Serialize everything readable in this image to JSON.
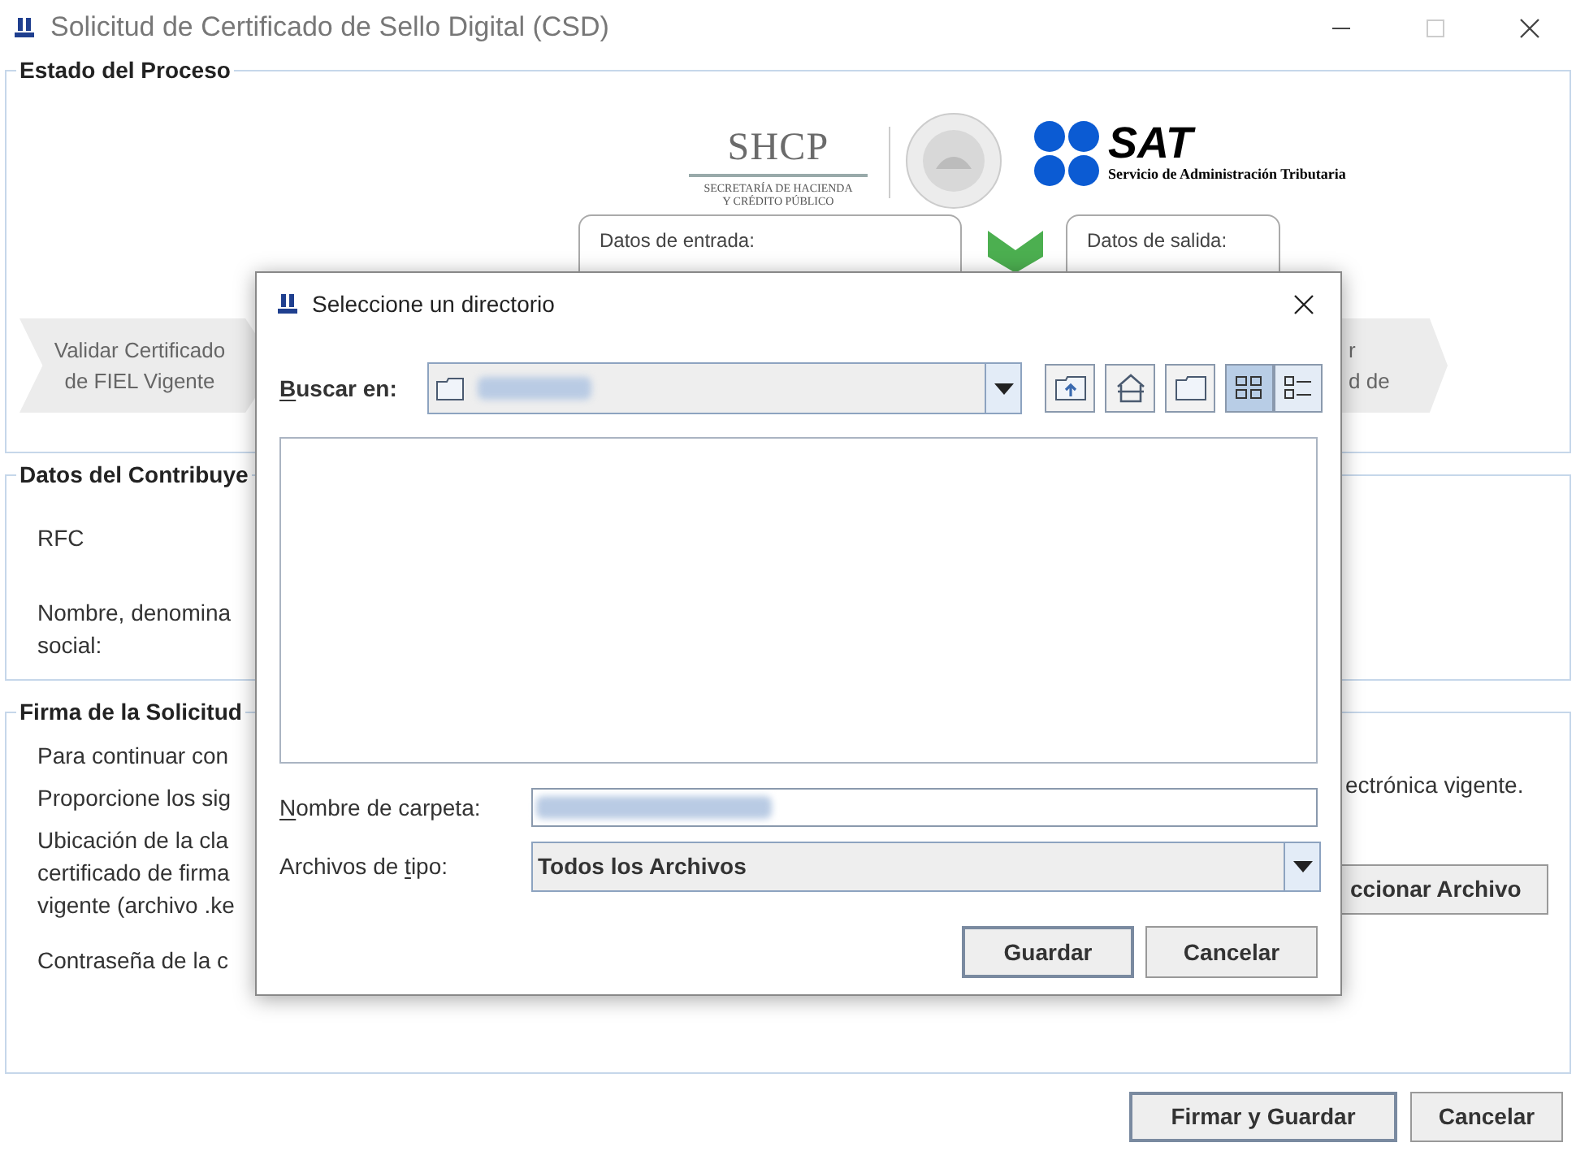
{
  "window": {
    "title": "Solicitud de Certificado de Sello Digital (CSD)"
  },
  "estado": {
    "title": "Estado del Proceso",
    "shcp": {
      "name": "SHCP",
      "lines": [
        "SECRETARÍA DE HACIENDA",
        "Y CRÉDITO PÚBLICO"
      ]
    },
    "sat": {
      "name": "SAT",
      "subtitle": "Servicio de Administración Tributaria"
    },
    "input_box": {
      "title": "Datos de entrada:"
    },
    "output_box": {
      "title": "Datos de salida:"
    },
    "steps": [
      {
        "lines": [
          "Validar Certificado",
          "de FIEL Vigente"
        ]
      },
      {
        "lines": [
          "r",
          "d de"
        ]
      }
    ]
  },
  "contribuyente": {
    "title": "Datos del Contribuye",
    "fields": [
      {
        "lines": [
          "RFC"
        ]
      },
      {
        "lines": [
          "Nombre, denomina",
          "social:"
        ]
      }
    ]
  },
  "firma": {
    "title": "Firma de la Solicitud",
    "rows": [
      {
        "lines": [
          "Para continuar con"
        ]
      },
      {
        "lines": [
          "Proporcione los sig"
        ]
      },
      {
        "lines": [
          "Ubicación de la cla",
          "certificado de firma",
          "vigente (archivo .ke"
        ]
      },
      {
        "lines": [
          "Contraseña de la c"
        ]
      }
    ],
    "notice_end": "ectrónica vigente.",
    "file_button": "ccionar Archivo"
  },
  "buttons": [
    {
      "label": "Firmar y Guardar",
      "default": true
    },
    {
      "label": "Cancelar",
      "default": false
    }
  ],
  "dialog": {
    "title": "Seleccione un directorio",
    "look_in": {
      "label": {
        "key": "B",
        "after": "uscar en:"
      }
    },
    "tool_buttons": [
      {
        "kind": "up"
      },
      {
        "kind": "home"
      },
      {
        "kind": "new-folder"
      }
    ],
    "view_buttons": [
      {
        "kind": "list",
        "selected": true
      },
      {
        "kind": "details",
        "selected": false
      }
    ],
    "folder_name": {
      "label": {
        "key": "N",
        "after": "ombre de carpeta:"
      }
    },
    "file_type": {
      "label": {
        "before": "Archivos de ",
        "key": "t",
        "after": "ipo:"
      },
      "value": "Todos los Archivos"
    },
    "buttons": [
      {
        "label": "Guardar",
        "default": true
      },
      {
        "label": "Cancelar",
        "default": false
      }
    ]
  }
}
